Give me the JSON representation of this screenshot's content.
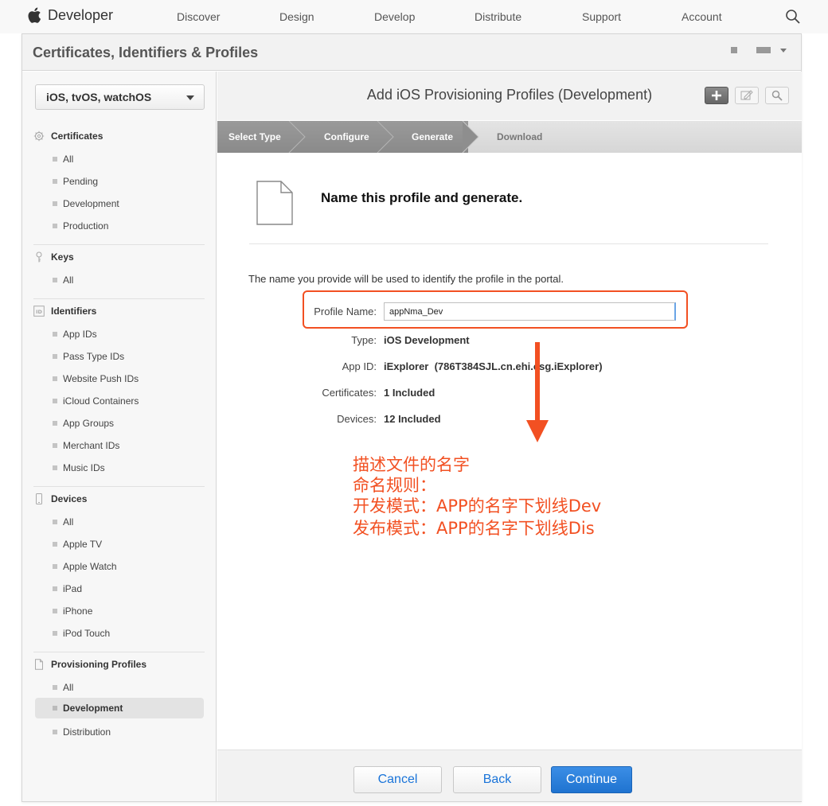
{
  "global_nav": {
    "brand": "Developer",
    "items": [
      "Discover",
      "Design",
      "Develop",
      "Distribute",
      "Support",
      "Account"
    ]
  },
  "header": {
    "title": "Certificates, Identifiers & Profiles"
  },
  "sidebar": {
    "platform": "iOS, tvOS, watchOS",
    "sections": [
      {
        "title": "Certificates",
        "icon": "gear-icon",
        "items": [
          "All",
          "Pending",
          "Development",
          "Production"
        ]
      },
      {
        "title": "Keys",
        "icon": "key-icon",
        "items": [
          "All"
        ]
      },
      {
        "title": "Identifiers",
        "icon": "id-icon",
        "items": [
          "App IDs",
          "Pass Type IDs",
          "Website Push IDs",
          "iCloud Containers",
          "App Groups",
          "Merchant IDs",
          "Music IDs"
        ]
      },
      {
        "title": "Devices",
        "icon": "device-icon",
        "items": [
          "All",
          "Apple TV",
          "Apple Watch",
          "iPad",
          "iPhone",
          "iPod Touch"
        ]
      },
      {
        "title": "Provisioning Profiles",
        "icon": "document-icon",
        "items": [
          "All",
          "Development",
          "Distribution"
        ]
      }
    ],
    "active_item": "Development"
  },
  "content": {
    "page_title": "Add iOS Provisioning Profiles (Development)",
    "steps": [
      "Select Type",
      "Configure",
      "Generate",
      "Download"
    ],
    "step_title": "Name this profile and generate.",
    "description": "The name you provide will be used to identify the profile in the portal.",
    "form": {
      "profile_name_label": "Profile Name:",
      "profile_name_value": "appNma_Dev",
      "type_label": "Type:",
      "type_value": "iOS Development",
      "app_id_label": "App ID:",
      "app_id_value": "iExplorer  (786T384SJL.cn.ehi.csg.iExplorer)",
      "certificates_label": "Certificates:",
      "certificates_value": "1 Included",
      "devices_label": "Devices:",
      "devices_value": "12 Included"
    },
    "annotation": [
      "描述文件的名字",
      "命名规则：",
      "开发模式：APP的名字下划线Dev",
      "发布模式：APP的名字下划线Dis"
    ],
    "buttons": {
      "cancel": "Cancel",
      "back": "Back",
      "continue": "Continue"
    }
  },
  "colors": {
    "annotation": "#f25022",
    "primary_button": "#1f73d0",
    "link": "#1a74d9"
  }
}
